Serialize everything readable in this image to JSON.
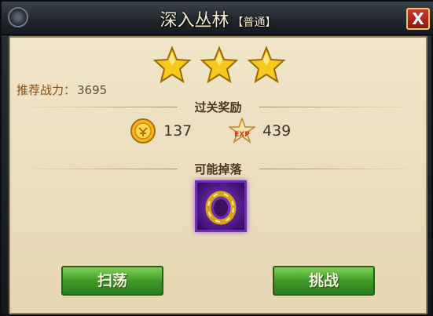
{
  "dialog": {
    "title": "深入丛林",
    "difficulty": "【普通】",
    "close_label": "X"
  },
  "stars": {
    "earned": 3,
    "total": 3
  },
  "recommended_power": {
    "label": "推荐战力：",
    "value": "3695"
  },
  "rewards": {
    "heading": "过关奖励",
    "gold": {
      "icon": "gold-coin-icon",
      "value": "137"
    },
    "exp": {
      "icon": "exp-star-icon",
      "value": "439",
      "badge": "EXP"
    }
  },
  "drops": {
    "heading": "可能掉落",
    "items": [
      {
        "icon": "gold-ring-icon"
      }
    ]
  },
  "buttons": {
    "sweep": "扫荡",
    "challenge": "挑战"
  },
  "colors": {
    "accent_gold": "#f5c518",
    "button_green": "#3f9a28",
    "item_purple": "#6e2fb4",
    "close_red": "#c22a20"
  }
}
